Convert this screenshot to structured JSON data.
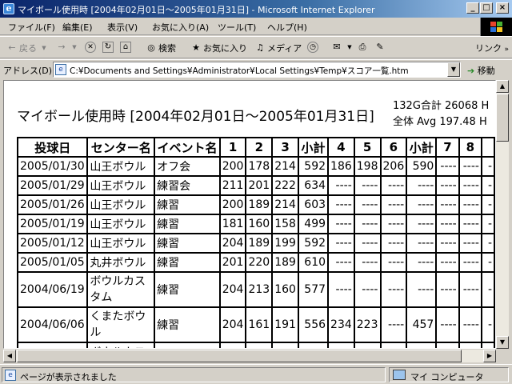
{
  "window": {
    "title": "マイボール使用時 [2004年02月01日～2005年01月31日] - Microsoft Internet Explorer",
    "min_label": "_",
    "max_label": "□",
    "close_label": "×"
  },
  "menu": {
    "items": [
      "ファイル(F)",
      "編集(E)",
      "表示(V)",
      "お気に入り(A)",
      "ツール(T)",
      "ヘルプ(H)"
    ]
  },
  "toolbar": {
    "back_label": "戻る",
    "search_label": "検索",
    "favorites_label": "お気に入り",
    "media_label": "メディア",
    "links_label": "リンク"
  },
  "address": {
    "label": "アドレス(D)",
    "url": "C:¥Documents and Settings¥Administrator¥Local Settings¥Temp¥スコア一覧.htm",
    "go_label": "移動"
  },
  "page": {
    "title": "マイボール使用時 [2004年02月01日～2005年01月31日]",
    "stats_line1": "132G合計  26068 H",
    "stats_line2": "全体 Avg  197.48 H"
  },
  "table": {
    "headers": [
      "投球日",
      "センター名",
      "イベント名",
      "1",
      "2",
      "3",
      "小計",
      "4",
      "5",
      "6",
      "小計",
      "7",
      "8",
      ""
    ],
    "rows": [
      [
        "2005/01/30",
        "山王ボウル",
        "オフ会",
        "200",
        "178",
        "214",
        "592",
        "186",
        "198",
        "206",
        "590",
        "----",
        "----",
        "-"
      ],
      [
        "2005/01/29",
        "山王ボウル",
        "練習会",
        "211",
        "201",
        "222",
        "634",
        "----",
        "----",
        "----",
        "----",
        "----",
        "----",
        "-"
      ],
      [
        "2005/01/26",
        "山王ボウル",
        "練習",
        "200",
        "189",
        "214",
        "603",
        "----",
        "----",
        "----",
        "----",
        "----",
        "----",
        "-"
      ],
      [
        "2005/01/19",
        "山王ボウル",
        "練習",
        "181",
        "160",
        "158",
        "499",
        "----",
        "----",
        "----",
        "----",
        "----",
        "----",
        "-"
      ],
      [
        "2005/01/12",
        "山王ボウル",
        "練習",
        "204",
        "189",
        "199",
        "592",
        "----",
        "----",
        "----",
        "----",
        "----",
        "----",
        "-"
      ],
      [
        "2005/01/05",
        "丸井ボウル",
        "練習",
        "201",
        "220",
        "189",
        "610",
        "----",
        "----",
        "----",
        "----",
        "----",
        "----",
        "-"
      ],
      [
        "2004/06/19",
        "ボウルカスタム",
        "練習",
        "204",
        "213",
        "160",
        "577",
        "----",
        "----",
        "----",
        "----",
        "----",
        "----",
        "-"
      ],
      [
        "2004/06/06",
        "くまたボウル",
        "練習",
        "204",
        "161",
        "191",
        "556",
        "234",
        "223",
        "----",
        "457",
        "----",
        "----",
        "-"
      ]
    ],
    "partial_row_center": "ボウルカス"
  },
  "status": {
    "text": "ページが表示されました",
    "zone": "マイ コンピュータ"
  },
  "colors": {
    "titlebar_start": "#0a246a",
    "titlebar_end": "#a6caf0",
    "chrome": "#d4d0c8"
  }
}
